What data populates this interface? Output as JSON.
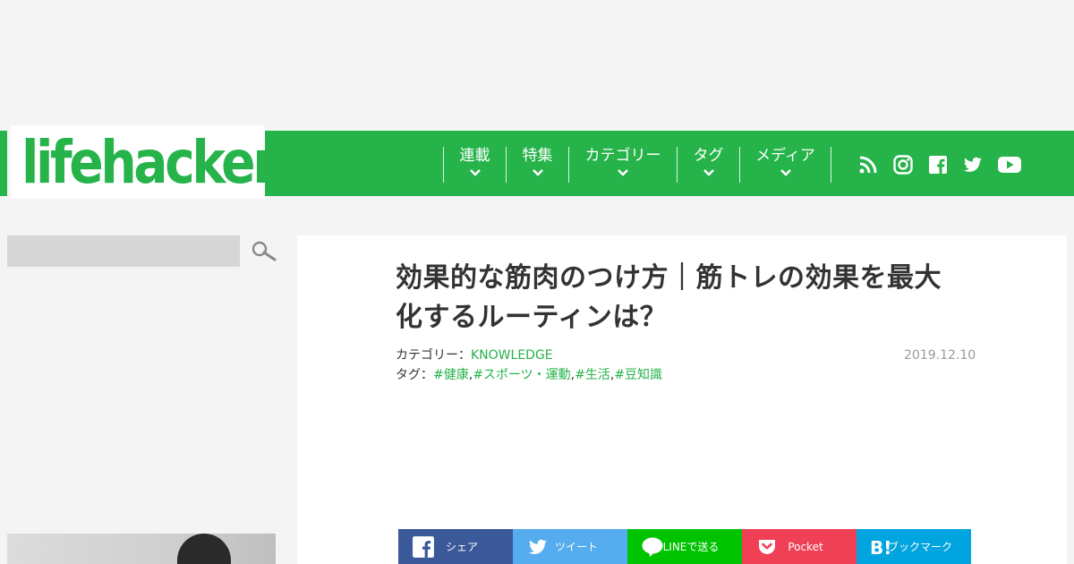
{
  "header": {
    "logo_text": "lifehacker",
    "nav": [
      {
        "label": "連載"
      },
      {
        "label": "特集"
      },
      {
        "label": "カテゴリー"
      },
      {
        "label": "タグ"
      },
      {
        "label": "メディア"
      }
    ],
    "social_icons": [
      "rss-icon",
      "instagram-icon",
      "facebook-icon",
      "twitter-icon",
      "youtube-icon"
    ],
    "brand_color": "#25b34a"
  },
  "sidebar": {
    "search_placeholder": "",
    "search_icon": "search-icon"
  },
  "article": {
    "title": "効果的な筋肉のつけ方｜筋トレの効果を最大化するルーティンは？",
    "category_prefix": "カテゴリー：",
    "category": "KNOWLEDGE",
    "tags_prefix": "タグ：",
    "tags": [
      "#健康",
      "#スポーツ・運動",
      "#生活",
      "#豆知識"
    ],
    "date": "2019.12.10"
  },
  "share": [
    {
      "label": "シェア",
      "icon": "facebook-icon",
      "color": "#3b5998"
    },
    {
      "label": "ツイート",
      "icon": "twitter-icon",
      "color": "#55acee"
    },
    {
      "label": "LINEで送る",
      "icon": "line-icon",
      "color": "#00c300"
    },
    {
      "label": "Pocket",
      "icon": "pocket-icon",
      "color": "#ef4056"
    },
    {
      "label": "ブックマーク",
      "icon": "hatena-bookmark-icon",
      "color": "#00a4de"
    }
  ]
}
